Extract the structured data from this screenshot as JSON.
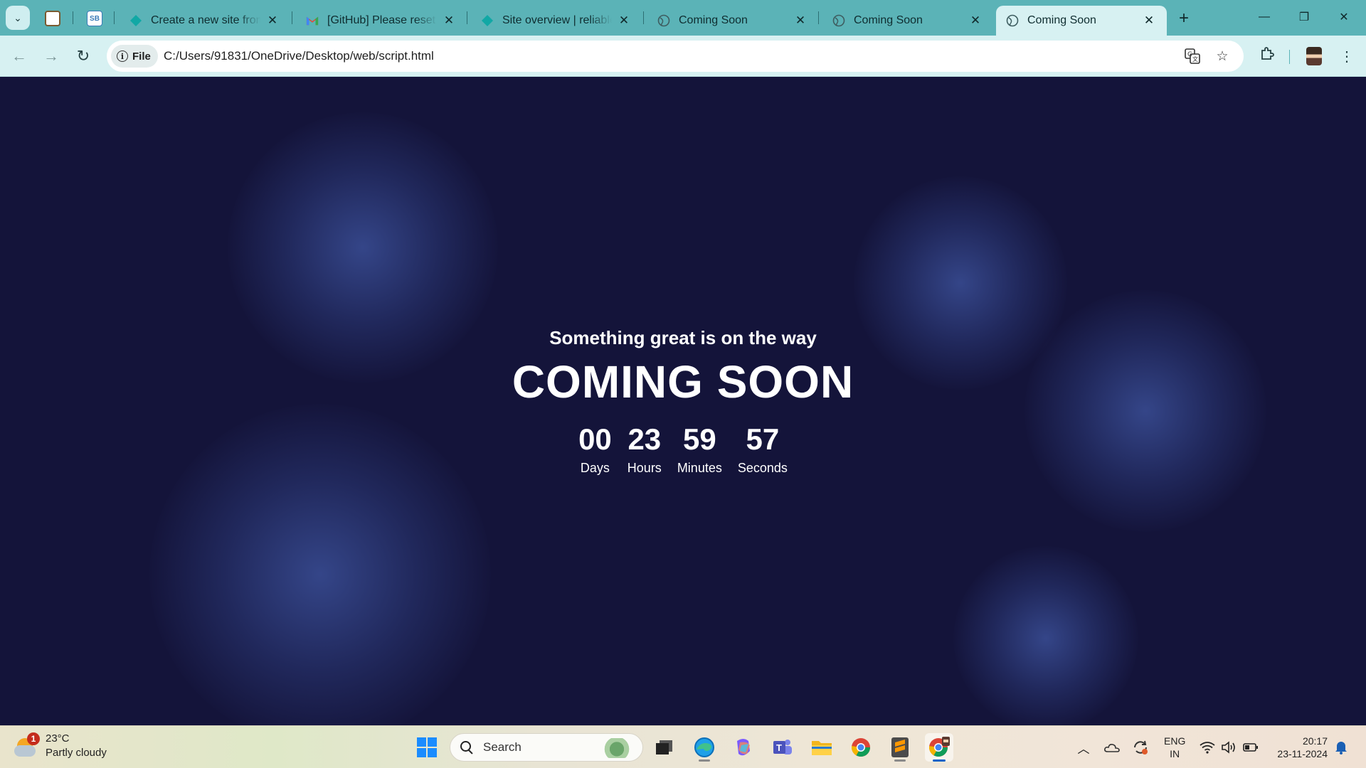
{
  "browser": {
    "tabs": [
      {
        "title": "Create a new site from git",
        "favicon": "netlify-icon",
        "active": false
      },
      {
        "title": "[GitHub] Please reset your password",
        "favicon": "gmail-icon",
        "active": false
      },
      {
        "title": "Site overview | reliable-",
        "favicon": "netlify-icon",
        "active": false
      },
      {
        "title": "Coming Soon",
        "favicon": "globe-icon",
        "active": false
      },
      {
        "title": "Coming Soon",
        "favicon": "globe-icon",
        "active": false
      },
      {
        "title": "Coming Soon",
        "favicon": "globe-icon",
        "active": true
      }
    ],
    "pinned_tabs": [
      {
        "favicon": "college-logo-icon"
      },
      {
        "favicon": "sb-icon",
        "text": "SB"
      }
    ],
    "address": {
      "chip_label": "File",
      "url": "C:/Users/91831/OneDrive/Desktop/web/script.html"
    },
    "accent_color": "#5bb3b7"
  },
  "page": {
    "tagline": "Something great is on the way",
    "headline": "COMING SOON",
    "countdown": [
      {
        "value": "00",
        "label": "Days"
      },
      {
        "value": "23",
        "label": "Hours"
      },
      {
        "value": "59",
        "label": "Minutes"
      },
      {
        "value": "57",
        "label": "Seconds"
      }
    ],
    "background_color": "#14143a"
  },
  "taskbar": {
    "weather": {
      "temp": "23°C",
      "condition": "Partly cloudy",
      "badge": "1"
    },
    "search_placeholder": "Search",
    "language": {
      "line1": "ENG",
      "line2": "IN"
    },
    "clock": {
      "time": "20:17",
      "date": "23-11-2024"
    }
  }
}
